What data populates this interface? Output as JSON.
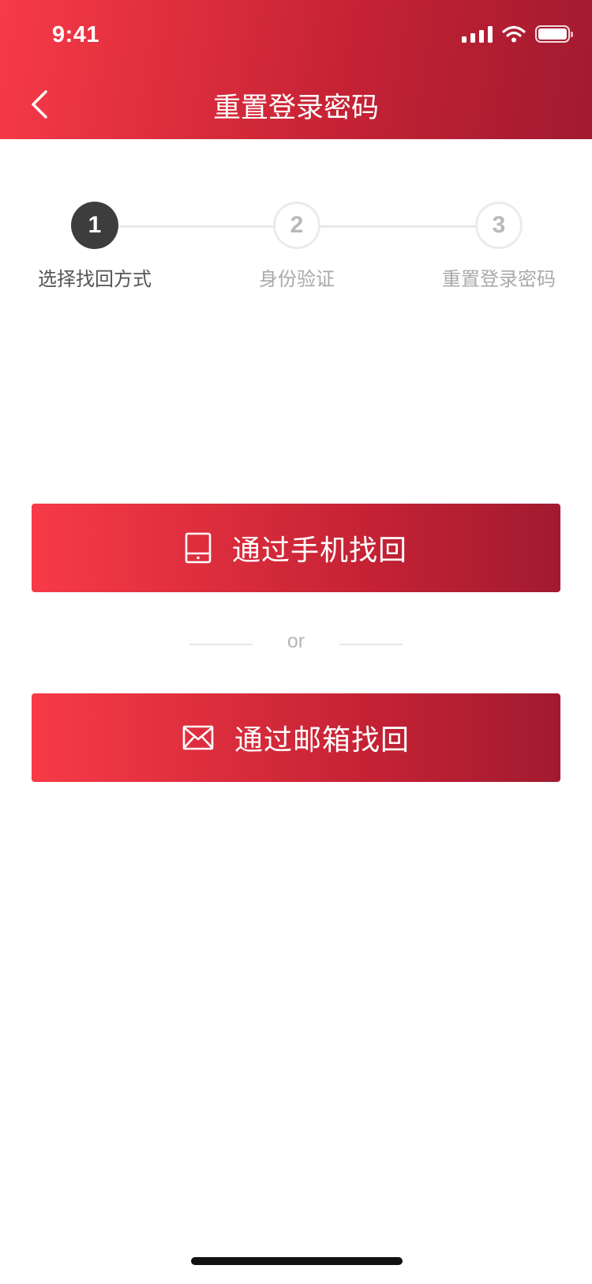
{
  "status_bar": {
    "time": "9:41"
  },
  "header": {
    "title": "重置登录密码"
  },
  "steps": [
    {
      "number": "1",
      "label": "选择找回方式"
    },
    {
      "number": "2",
      "label": "身份验证"
    },
    {
      "number": "3",
      "label": "重置登录密码"
    }
  ],
  "buttons": {
    "phone": {
      "label": "通过手机找回",
      "icon": "tablet-icon"
    },
    "email": {
      "label": "通过邮箱找回",
      "icon": "mail-icon"
    }
  },
  "divider": {
    "text": "or"
  },
  "colors": {
    "accent_start": "#f73a47",
    "accent_end": "#a21a30",
    "step_active": "#3d3d3d",
    "step_inactive": "#b9b9b9"
  }
}
